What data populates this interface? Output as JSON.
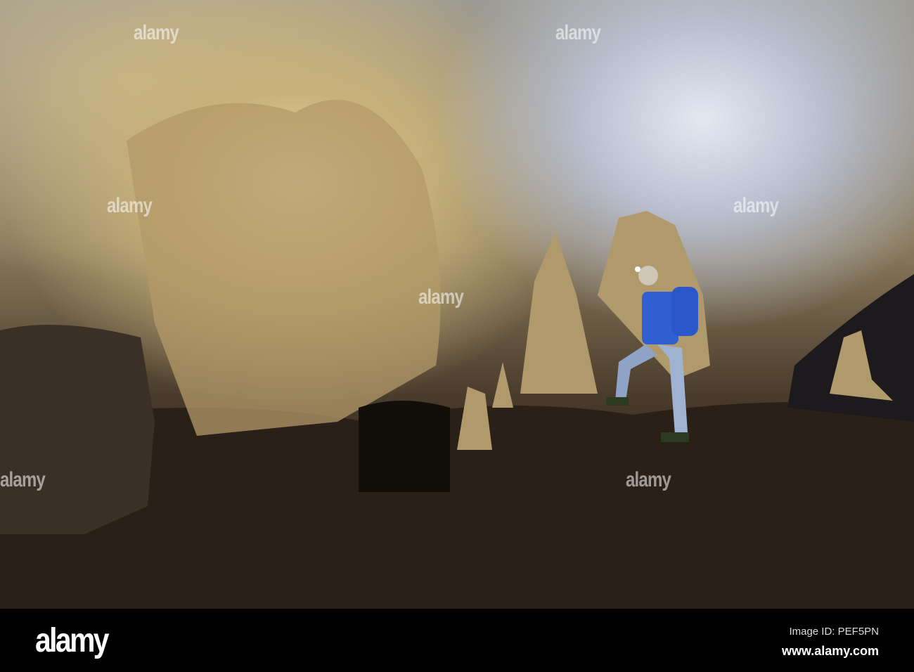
{
  "watermark": {
    "text": "alamy"
  },
  "footer": {
    "logo": "alamy",
    "image_id": "Image ID: PEF5PN",
    "url": "www.alamy.com"
  },
  "colors": {
    "jacket": "#2f5fd0",
    "bar": "#000000"
  }
}
